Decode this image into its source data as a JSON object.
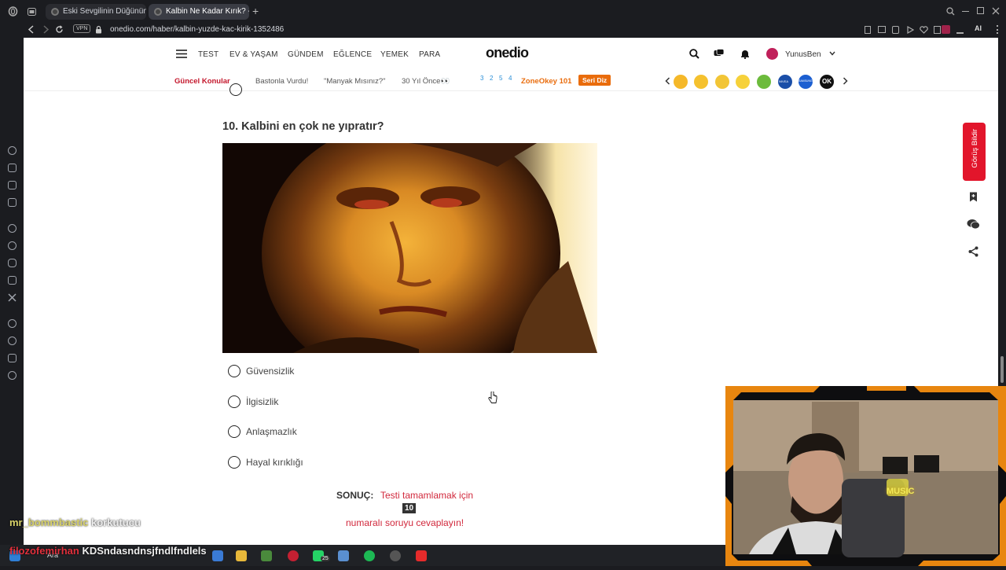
{
  "browser": {
    "tabs": [
      {
        "title": "Eski Sevgilinin Düğününde",
        "active": false
      },
      {
        "title": "Kalbin Ne Kadar Kırık? - On",
        "active": true
      }
    ],
    "vpn_label": "VPN",
    "url": "onedio.com/haber/kalbin-yuzde-kac-kirik-1352486",
    "ai_label": "AI"
  },
  "site": {
    "logo": "onedio",
    "nav": [
      "TEST",
      "EV & YAŞAM",
      "GÜNDEM",
      "EĞLENCE",
      "YEMEK",
      "PARA"
    ],
    "username": "YunusBen",
    "trending_title": "Güncel Konular",
    "trending": [
      "Bastonla Vurdu!",
      "\"Manyak Mısınız?\"",
      "30 Yıl Önce👀"
    ],
    "number_strip": [
      "3",
      "2",
      "5",
      "4"
    ],
    "zoneokey": "ZoneOkey 101",
    "seri_diz": "Seri Diz",
    "brand_badges": [
      "NIVEA",
      "SAMSUNG",
      "OK"
    ],
    "feedback_label": "Görüş Bildir"
  },
  "quiz": {
    "question": "10. Kalbini en çok ne yıpratır?",
    "options": [
      "Güvensizlik",
      "İlgisizlik",
      "Anlaşmazlık",
      "Hayal kırıklığı"
    ],
    "result_label": "SONUÇ:",
    "result_text_1": "Testi tamamlamak için",
    "result_number": "10",
    "result_text_2": "numaralı soruyu cevaplayın!"
  },
  "stream": {
    "chat": [
      {
        "user": "mr_bommbastic",
        "message": "korkutucu",
        "user_color": "#d9d36a"
      },
      {
        "user": "filozofemirhan",
        "message": "KDSndasndnsjfndlfndlels",
        "user_color": "#e1303c"
      }
    ],
    "webcam_sign": "MUSIC"
  },
  "taskbar": {
    "search_label": "Ara",
    "badge": "25"
  },
  "colors": {
    "accent_red": "#e2152b",
    "trend_red": "#c4172c",
    "zone_orange": "#e96c0c",
    "result_red": "#d1283c"
  }
}
